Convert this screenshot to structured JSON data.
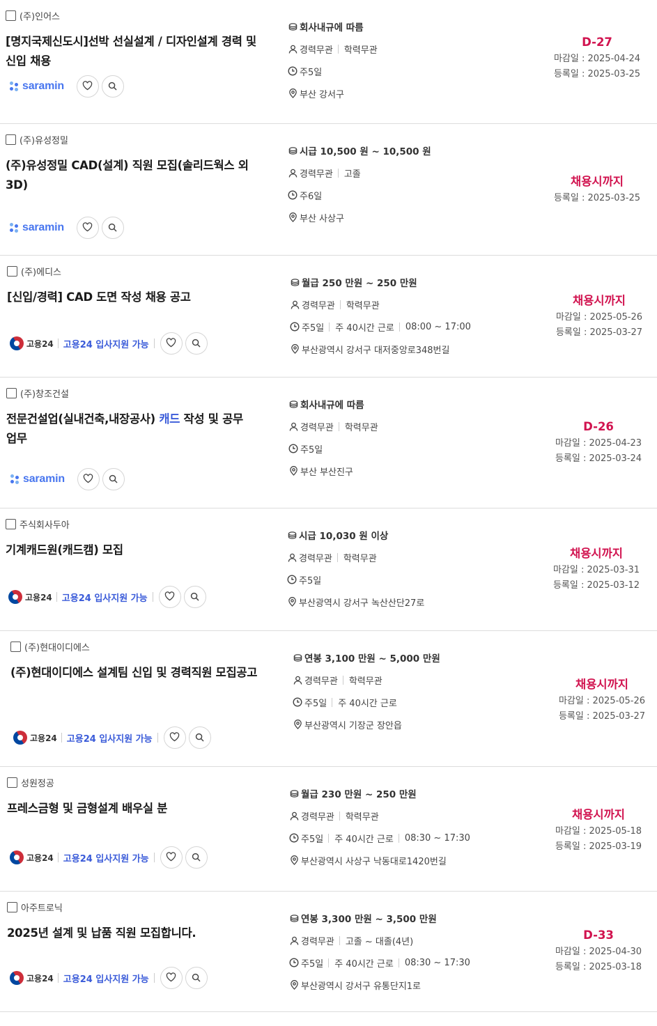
{
  "labels": {
    "deadline_prefix": "마감일 : ",
    "registered_prefix": "등록일 : ",
    "saramin": "saramin",
    "goyong24": "고용24",
    "goyong24_support": "고용24 입사지원 가능"
  },
  "colors": {
    "dday": "#d1134f",
    "link_blue": "#3a5bd9",
    "saramin_blue": "#4876ef"
  },
  "jobs": [
    {
      "company": "(주)인어스",
      "title": "[명지국제신도시]선박 선실설계 / 디자인설계 경력 및 신입 채용",
      "title_highlight": "",
      "title_after": "",
      "source": "saramin",
      "salary": "회사내규에 따름",
      "career": "경력무관",
      "education": "학력무관",
      "workdays": "주5일",
      "hours": "",
      "time": "",
      "location": "부산 강서구",
      "dday": "D-27",
      "deadline": "2025-04-24",
      "registered": "2025-03-25"
    },
    {
      "company": "(주)유성정밀",
      "title": "(주)유성정밀 CAD(설계) 직원 모집(솔리드웍스 외 3D)",
      "title_highlight": "",
      "title_after": "",
      "source": "saramin",
      "salary": "시급 10,500 원 ~ 10,500 원",
      "career": "경력무관",
      "education": "고졸",
      "workdays": "주6일",
      "hours": "",
      "time": "",
      "location": "부산 사상구",
      "dday": "채용시까지",
      "deadline": "",
      "registered": "2025-03-25"
    },
    {
      "company": "(주)에디스",
      "title": "[신입/경력] CAD 도면 작성 채용 공고",
      "title_highlight": "",
      "title_after": "",
      "source": "goyong24",
      "salary": "월급 250 만원 ~ 250 만원",
      "career": "경력무관",
      "education": "학력무관",
      "workdays": "주5일",
      "hours": "주 40시간 근로",
      "time": "08:00 ~ 17:00",
      "location": "부산광역시 강서구 대저중앙로348번길",
      "dday": "채용시까지",
      "deadline": "2025-05-26",
      "registered": "2025-03-27"
    },
    {
      "company": "(주)창조건설",
      "title": "전문건설업(실내건축,내장공사) ",
      "title_highlight": "캐드",
      "title_after": " 작성 및 공무 업무",
      "source": "saramin",
      "salary": "회사내규에 따름",
      "career": "경력무관",
      "education": "학력무관",
      "workdays": "주5일",
      "hours": "",
      "time": "",
      "location": "부산 부산진구",
      "dday": "D-26",
      "deadline": "2025-04-23",
      "registered": "2025-03-24"
    },
    {
      "company": "주식회사두아",
      "title": "기계캐드원(캐드캠) 모집",
      "title_highlight": "",
      "title_after": "",
      "source": "goyong24",
      "salary": "시급 10,030 원 이상",
      "career": "경력무관",
      "education": "학력무관",
      "workdays": "주5일",
      "hours": "",
      "time": "",
      "location": "부산광역시 강서구 녹산산단27로",
      "dday": "채용시까지",
      "deadline": "2025-03-31",
      "registered": "2025-03-12"
    },
    {
      "company": "(주)현대이디에스",
      "title": "(주)현대이디에스 설계팀 신입 및 경력직원 모집공고",
      "title_highlight": "",
      "title_after": "",
      "source": "goyong24",
      "salary": "연봉 3,100 만원 ~ 5,000 만원",
      "career": "경력무관",
      "education": "학력무관",
      "workdays": "주5일",
      "hours": "주 40시간 근로",
      "time": "",
      "location": "부산광역시 기장군 장안읍",
      "dday": "채용시까지",
      "deadline": "2025-05-26",
      "registered": "2025-03-27"
    },
    {
      "company": "성원정공",
      "title": "프레스금형 및 금형설계 배우실 분",
      "title_highlight": "",
      "title_after": "",
      "source": "goyong24",
      "salary": "월급 230 만원 ~ 250 만원",
      "career": "경력무관",
      "education": "학력무관",
      "workdays": "주5일",
      "hours": "주 40시간 근로",
      "time": "08:30 ~ 17:30",
      "location": "부산광역시 사상구 낙동대로1420번길",
      "dday": "채용시까지",
      "deadline": "2025-05-18",
      "registered": "2025-03-19"
    },
    {
      "company": "아주트로닉",
      "title": "2025년 설계 및 납품 직원 모집합니다.",
      "title_highlight": "",
      "title_after": "",
      "source": "goyong24",
      "salary": "연봉 3,300 만원 ~ 3,500 만원",
      "career": "경력무관",
      "education": "고졸 ~ 대졸(4년)",
      "workdays": "주5일",
      "hours": "주 40시간 근로",
      "time": "08:30 ~ 17:30",
      "location": "부산광역시 강서구 유통단지1로",
      "dday": "D-33",
      "deadline": "2025-04-30",
      "registered": "2025-03-18"
    }
  ]
}
